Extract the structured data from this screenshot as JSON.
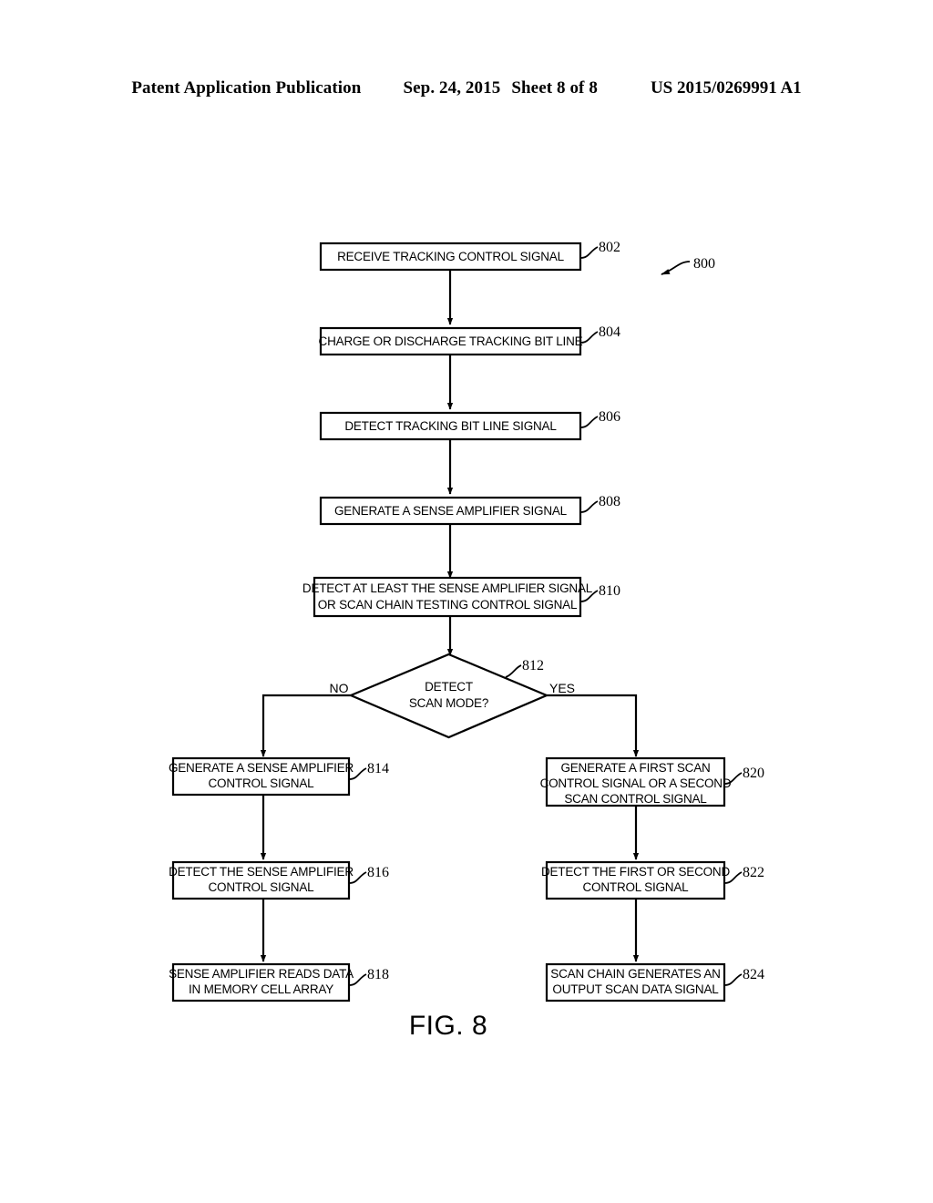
{
  "header": {
    "publication": "Patent Application Publication",
    "date": "Sep. 24, 2015",
    "sheet": "Sheet 8 of 8",
    "patent_number": "US 2015/0269991 A1"
  },
  "figure": {
    "caption": "FIG. 8",
    "diagram_ref": "800",
    "branch_labels": {
      "no": "NO",
      "yes": "YES"
    },
    "nodes": [
      {
        "ref": "802",
        "type": "process",
        "lines": [
          "RECEIVE TRACKING CONTROL SIGNAL"
        ]
      },
      {
        "ref": "804",
        "type": "process",
        "lines": [
          "CHARGE OR DISCHARGE TRACKING BIT LINE"
        ]
      },
      {
        "ref": "806",
        "type": "process",
        "lines": [
          "DETECT TRACKING BIT LINE SIGNAL"
        ]
      },
      {
        "ref": "808",
        "type": "process",
        "lines": [
          "GENERATE A SENSE AMPLIFIER SIGNAL"
        ]
      },
      {
        "ref": "810",
        "type": "process",
        "lines": [
          "DETECT AT LEAST THE SENSE AMPLIFIER SIGNAL",
          "OR SCAN CHAIN TESTING CONTROL SIGNAL"
        ]
      },
      {
        "ref": "812",
        "type": "decision",
        "lines": [
          "DETECT",
          "SCAN MODE?"
        ]
      },
      {
        "ref": "814",
        "type": "process",
        "lines": [
          "GENERATE A SENSE AMPLIFIER",
          "CONTROL SIGNAL"
        ]
      },
      {
        "ref": "816",
        "type": "process",
        "lines": [
          "DETECT THE SENSE AMPLIFIER",
          "CONTROL SIGNAL"
        ]
      },
      {
        "ref": "818",
        "type": "process",
        "lines": [
          "SENSE AMPLIFIER READS DATA",
          "IN MEMORY CELL ARRAY"
        ]
      },
      {
        "ref": "820",
        "type": "process",
        "lines": [
          "GENERATE A FIRST SCAN",
          "CONTROL SIGNAL OR A SECOND",
          "SCAN CONTROL SIGNAL"
        ]
      },
      {
        "ref": "822",
        "type": "process",
        "lines": [
          "DETECT THE FIRST OR SECOND",
          "CONTROL SIGNAL"
        ]
      },
      {
        "ref": "824",
        "type": "process",
        "lines": [
          "SCAN CHAIN GENERATES AN",
          "OUTPUT SCAN DATA SIGNAL"
        ]
      }
    ]
  }
}
